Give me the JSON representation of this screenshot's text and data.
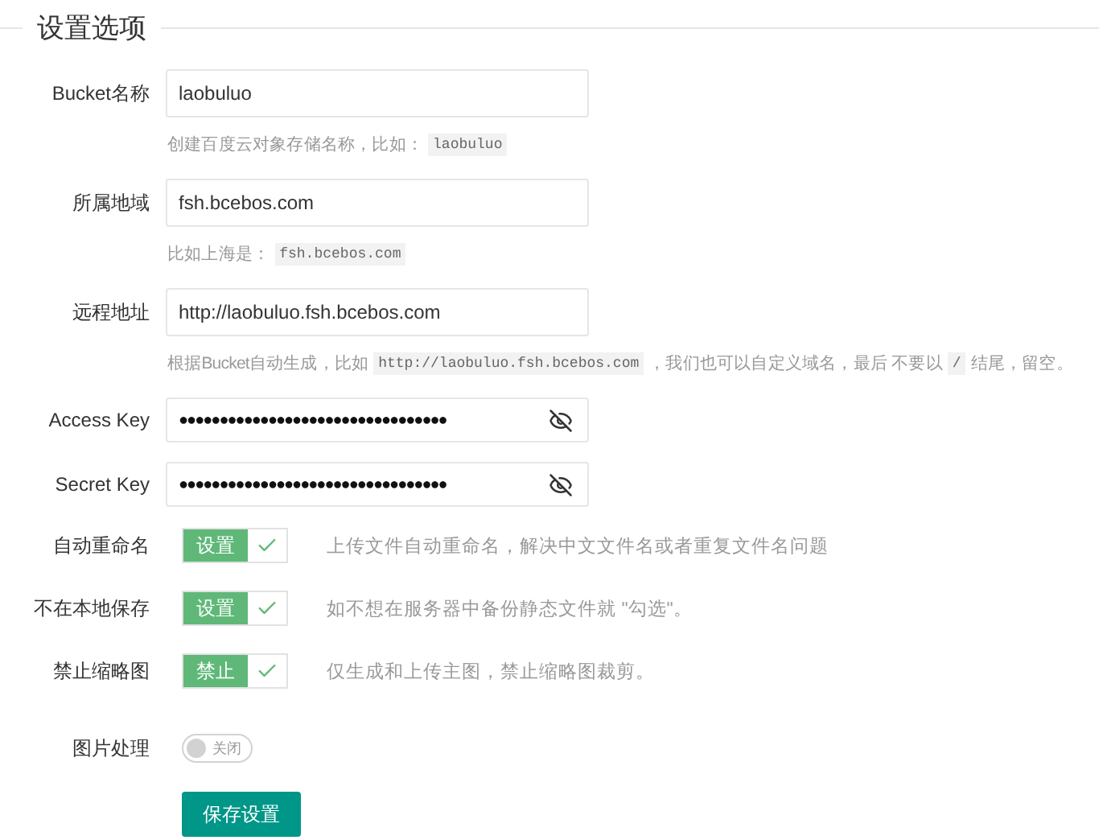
{
  "legend": "设置选项",
  "fields": [
    {
      "kind": "text",
      "label": "Bucket名称",
      "value": "laobuluo",
      "hint": [
        {
          "kind": "text",
          "text": "创建百度云对象存储名称，比如："
        },
        {
          "kind": "code",
          "text": "laobuluo"
        }
      ]
    },
    {
      "kind": "text",
      "label": "所属地域",
      "value": "fsh.bcebos.com",
      "hint": [
        {
          "kind": "text",
          "text": "比如上海是："
        },
        {
          "kind": "code",
          "text": "fsh.bcebos.com"
        }
      ]
    },
    {
      "kind": "text",
      "label": "远程地址",
      "value": "http://laobuluo.fsh.bcebos.com",
      "hint": [
        {
          "kind": "text",
          "text": "根据Bucket自动生成，比如"
        },
        {
          "kind": "code",
          "text": "http://laobuluo.fsh.bcebos.com"
        },
        {
          "kind": "text",
          "text": "，我们也可以自定义域名，最后 不要以"
        },
        {
          "kind": "code",
          "text": "/"
        },
        {
          "kind": "text",
          "text": "结尾，留空。"
        }
      ]
    },
    {
      "kind": "secret",
      "label": "Access Key",
      "value": "●●●●●●●●●●●●●●●●●●●●●●●●●●●●●●●●●"
    },
    {
      "kind": "secret",
      "label": "Secret Key",
      "value": "●●●●●●●●●●●●●●●●●●●●●●●●●●●●●●●●●"
    },
    {
      "kind": "check",
      "label": "自动重命名",
      "tag": "设置",
      "checked": true,
      "description": "上传文件自动重命名，解决中文文件名或者重复文件名问题"
    },
    {
      "kind": "check",
      "label": "不在本地保存",
      "tag": "设置",
      "checked": true,
      "description": "如不想在服务器中备份静态文件就 \"勾选\"。"
    },
    {
      "kind": "check",
      "label": "禁止缩略图",
      "tag": "禁止",
      "checked": true,
      "description": "仅生成和上传主图，禁止缩略图裁剪。"
    },
    {
      "kind": "switch",
      "label": "图片处理",
      "on": false,
      "state_text": "关闭"
    }
  ],
  "save_button": "保存设置"
}
